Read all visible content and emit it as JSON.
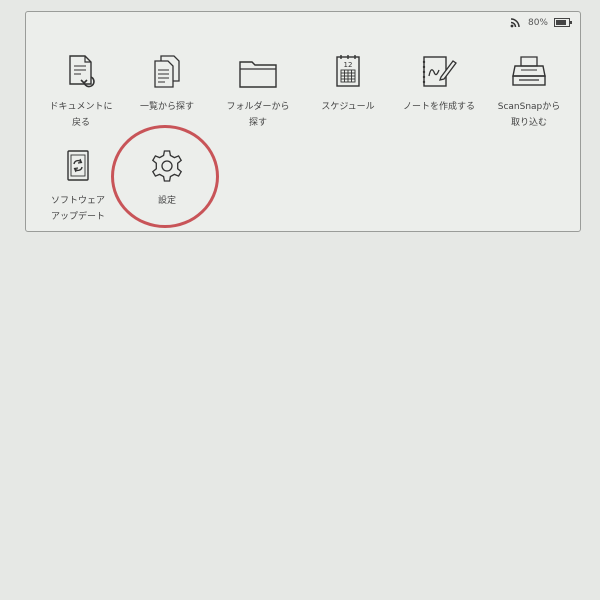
{
  "status": {
    "battery_percent": "80%",
    "battery_level": 0.8
  },
  "menu": {
    "items": [
      {
        "label": "ドキュメントに\n戻る",
        "icon": "document-return-icon"
      },
      {
        "label": "一覧から探す",
        "icon": "document-list-icon"
      },
      {
        "label": "フォルダーから\n探す",
        "icon": "folder-icon"
      },
      {
        "label": "スケジュール",
        "icon": "calendar-icon",
        "icon_text": "12"
      },
      {
        "label": "ノートを作成する",
        "icon": "note-pen-icon"
      },
      {
        "label": "ScanSnapから\n取り込む",
        "icon": "scanner-icon"
      },
      {
        "label": "ソフトウェア\nアップデート",
        "icon": "software-update-icon"
      },
      {
        "label": "設定",
        "icon": "gear-icon"
      }
    ]
  },
  "colors": {
    "highlight": "#c85458",
    "background": "#e6e8e5"
  }
}
